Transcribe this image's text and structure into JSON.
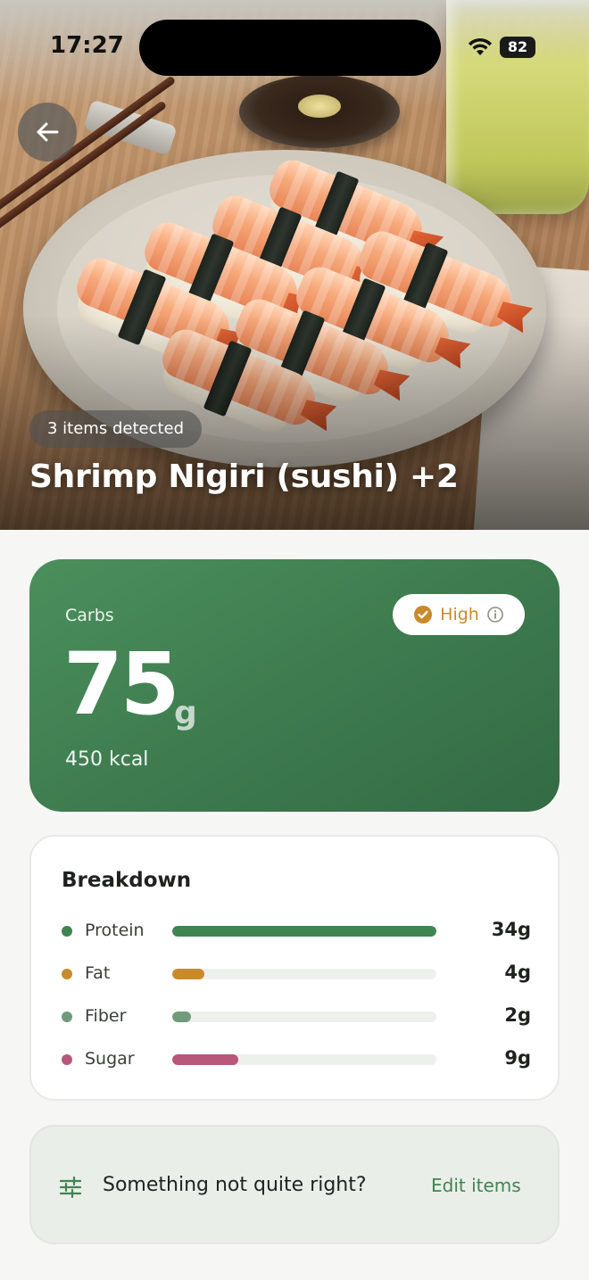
{
  "status_bar": {
    "time": "17:27",
    "battery": "82"
  },
  "hero": {
    "items_detected": "3 items detected",
    "title": "Shrimp Nigiri (sushi) +2"
  },
  "carbs": {
    "label": "Carbs",
    "value": "75",
    "unit": "g",
    "kcal": "450 kcal",
    "level": "High"
  },
  "breakdown": {
    "title": "Breakdown",
    "items": [
      {
        "name": "Protein",
        "value": "34g",
        "fill": 1.0,
        "color": "#3f8551"
      },
      {
        "name": "Fat",
        "value": "4g",
        "fill": 0.12,
        "color": "#c98a2b"
      },
      {
        "name": "Fiber",
        "value": "2g",
        "fill": 0.07,
        "color": "#6f9a7b"
      },
      {
        "name": "Sugar",
        "value": "9g",
        "fill": 0.25,
        "color": "#b8577a"
      }
    ]
  },
  "edit": {
    "question": "Something not quite right?",
    "link": "Edit items"
  },
  "colors": {
    "accent_green": "#3f8551",
    "card_green": "#3d7a4e",
    "warning_orange": "#c98a2b",
    "background": "#f6f7f4"
  }
}
